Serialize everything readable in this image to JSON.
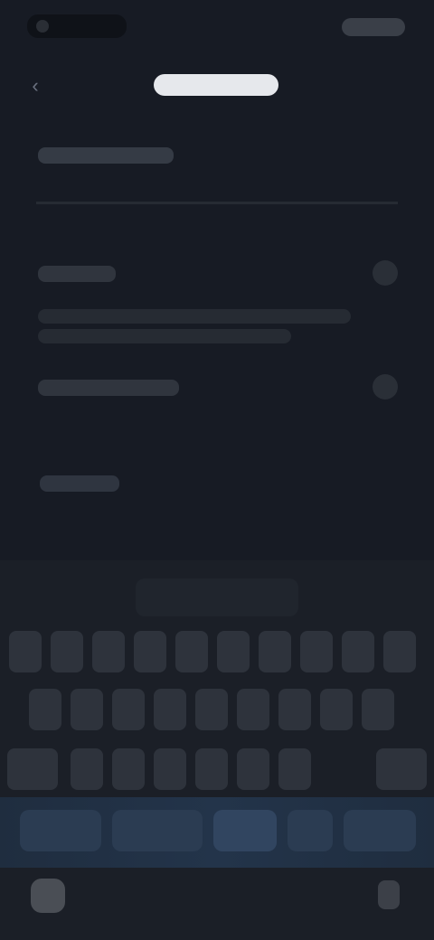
{
  "status_bar": {
    "time": "",
    "battery": ""
  },
  "header": {
    "back_icon": "chevron-left-icon",
    "title": ""
  },
  "settings": {
    "section_title": "",
    "rows": [
      {
        "label": "",
        "description_line1": "",
        "description_line2": ""
      },
      {
        "label": ""
      }
    ],
    "link_label": ""
  },
  "keyboard": {
    "suggestion": "",
    "rows": [
      [
        "",
        "",
        "",
        "",
        "",
        "",
        "",
        "",
        "",
        ""
      ],
      [
        "",
        "",
        "",
        "",
        "",
        "",
        "",
        "",
        ""
      ],
      [
        "",
        "",
        "",
        "",
        "",
        "",
        "",
        ""
      ]
    ],
    "bottom_keys": [
      "",
      "",
      "",
      "",
      ""
    ]
  },
  "colors": {
    "background": "#171b24",
    "keyboard_bg": "#1b1f27",
    "key_bg": "#2e333c",
    "bottom_bar_accent": "#23344a"
  }
}
